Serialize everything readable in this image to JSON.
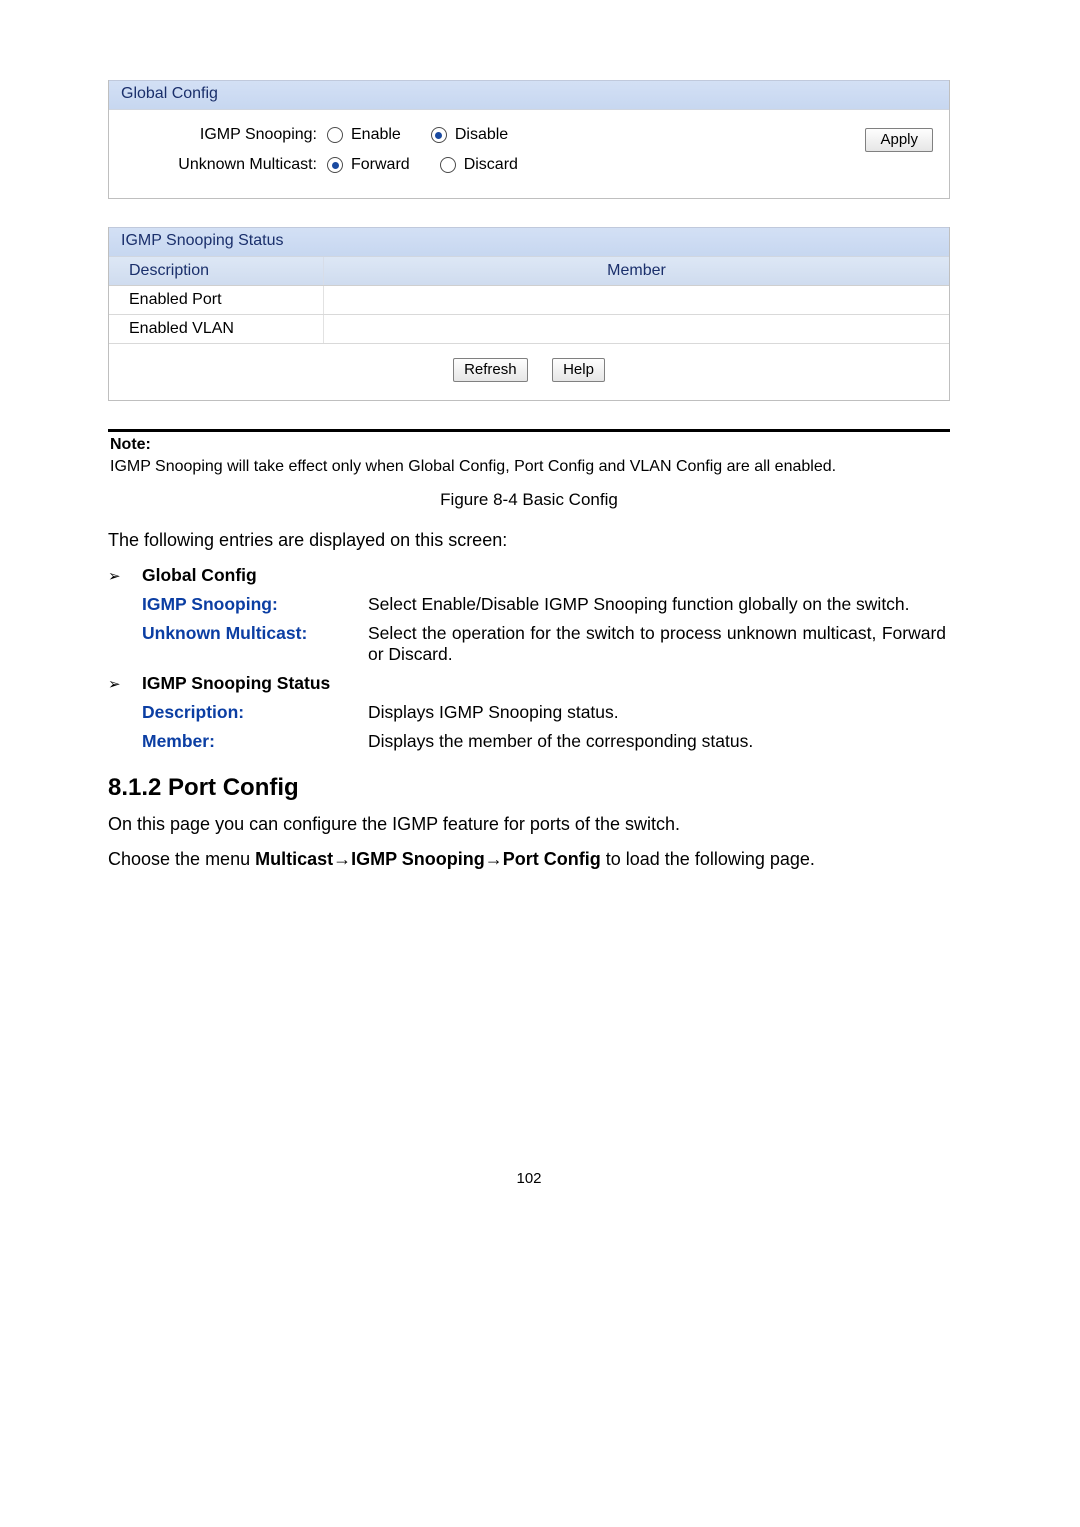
{
  "page_number": "102",
  "panel1": {
    "title": "Global Config",
    "igmpLabel": "IGMP Snooping:",
    "enable": "Enable",
    "disable": "Disable",
    "unknownLabel": "Unknown Multicast:",
    "forward": "Forward",
    "discard": "Discard",
    "apply": "Apply"
  },
  "panel2": {
    "title": "IGMP Snooping Status",
    "header_desc": "Description",
    "header_mem": "Member",
    "row1": "Enabled Port",
    "row2": "Enabled VLAN",
    "refresh": "Refresh",
    "help": "Help"
  },
  "note_heading": "Note:",
  "note_body": "IGMP Snooping will take effect only when Global Config, Port Config and VLAN Config are all enabled.",
  "figure_caption": "Figure 8-4 Basic Config",
  "intro_sentence": "The following entries are displayed on this screen:",
  "sections": {
    "globalConfig": {
      "heading": "Global Config",
      "igmp": {
        "term": "IGMP Snooping:",
        "body": "Select Enable/Disable IGMP Snooping function globally on the switch."
      },
      "unknown": {
        "term": "Unknown Multicast:",
        "body": "Select the operation for the switch to process unknown multicast, Forward or Discard."
      }
    },
    "status": {
      "heading": "IGMP Snooping Status",
      "desc": {
        "term": "Description:",
        "body": "Displays IGMP Snooping status."
      },
      "mem": {
        "term": "Member:",
        "body": "Displays the member of the corresponding status."
      }
    }
  },
  "port_config": {
    "heading": "8.1.2 Port Config",
    "line1": "On this page you can configure the IGMP feature for ports of the switch.",
    "nav_prefix": "Choose the menu ",
    "nav_bold1": "Multicast",
    "nav_sep": "→",
    "nav_bold2": "IGMP Snooping",
    "nav_bold3": "Port Config",
    "nav_suffix": " to load the following page."
  }
}
